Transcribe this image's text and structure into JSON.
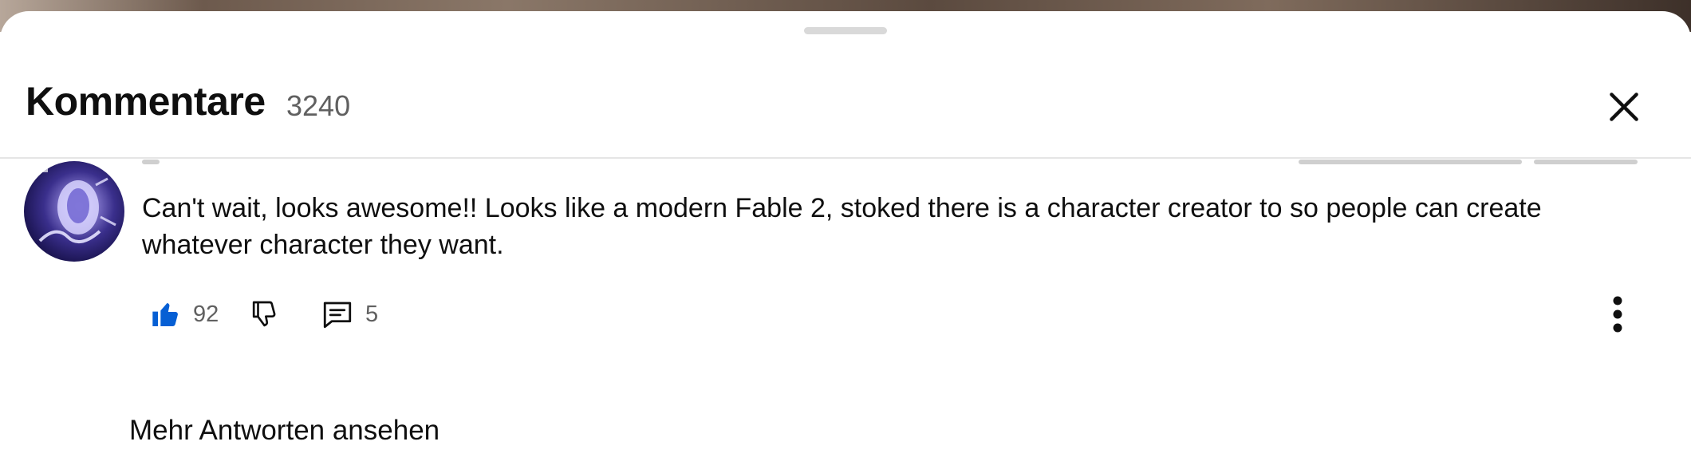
{
  "header": {
    "title": "Kommentare",
    "count": "3240",
    "close_icon": "close-icon"
  },
  "comment": {
    "avatar_icon": "avatar",
    "text_line1": "Can't wait, looks awesome!! Looks like a modern Fable 2, stoked there is a character creator to so people can create",
    "text_line2": "whatever character they want.",
    "likes": "92",
    "replies": "5",
    "like_icon": "thumbs-up-filled-icon",
    "dislike_icon": "thumbs-down-icon",
    "reply_icon": "comment-icon",
    "more_icon": "more-vertical-icon"
  },
  "footer": {
    "more_replies_label": "Mehr Antworten ansehen"
  },
  "colors": {
    "like_active": "#065fd4",
    "text_primary": "#0f0f0f",
    "text_secondary": "#606060"
  }
}
